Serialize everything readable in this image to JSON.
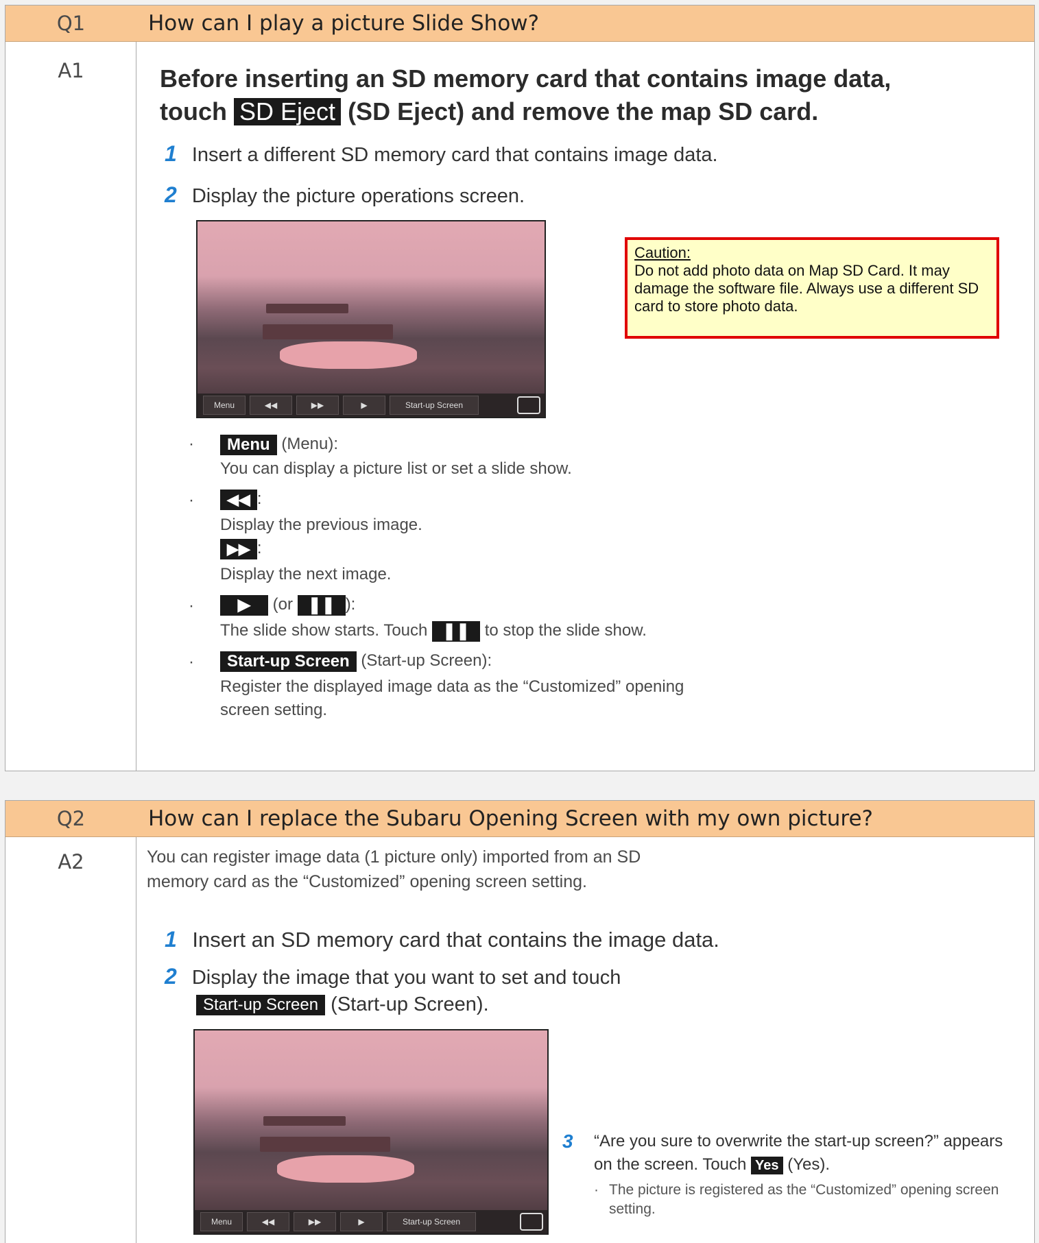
{
  "q1": {
    "num": "Q1",
    "question": "How can I play a picture Slide Show?",
    "answer_num": "A1",
    "heading_line1": "Before inserting an SD memory card that contains image data,",
    "heading_touch": "touch",
    "sd_eject_btn": "SD Eject",
    "heading_line2_rest": "(SD Eject) and remove the map SD card.",
    "step1_num": "1",
    "step1": "Insert a different SD memory card that contains image data.",
    "step2_num": "2",
    "step2": "Display the picture operations screen.",
    "caution_title": "Caution:",
    "caution_text": "Do not add photo data on Map SD Card.  It may damage the software file.  Always use a different SD card to store photo data.",
    "bullets": {
      "menu_btn": "Menu",
      "menu_suffix": "(Menu):",
      "menu_desc": "You can display a picture list or set a slide show.",
      "prev_desc": "Display the previous image.",
      "next_desc": "Display the next image.",
      "play_or": "(or",
      "play_close": "):",
      "play_desc_a": "The slide show starts. Touch",
      "play_desc_b": "to stop the slide show.",
      "startup_btn": "Start-up Screen",
      "startup_suffix": "(Start-up Screen):",
      "startup_desc1": "Register the displayed image data as the “Customized” opening",
      "startup_desc2": "screen setting."
    }
  },
  "photo_bar": {
    "menu": "Menu",
    "rew": "◀◀",
    "ff": "▶▶",
    "play": "▶",
    "startup": "Start-up Screen"
  },
  "q2": {
    "num": "Q2",
    "question": "How can I replace the Subaru Opening Screen with my own picture?",
    "answer_num": "A2",
    "intro1": "You can register image data (1 picture only) imported from an SD",
    "intro2": "memory card as the “Customized” opening screen setting.",
    "step1_num": "1",
    "step1": "Insert an SD memory card that contains the image data.",
    "step2_num": "2",
    "step2": "Display the image that you want to set and touch",
    "startup_btn": "Start-up Screen",
    "step2_suffix": "(Start-up Screen).",
    "step3_num": "3",
    "step3_line1": "“Are you sure to overwrite the start-up screen?” appears",
    "step3_line2a": "on the screen. Touch",
    "yes_btn": "Yes",
    "step3_line2b": "(Yes).",
    "step3_note1": "The picture is registered as the “Customized” opening screen",
    "step3_note2": "setting."
  }
}
